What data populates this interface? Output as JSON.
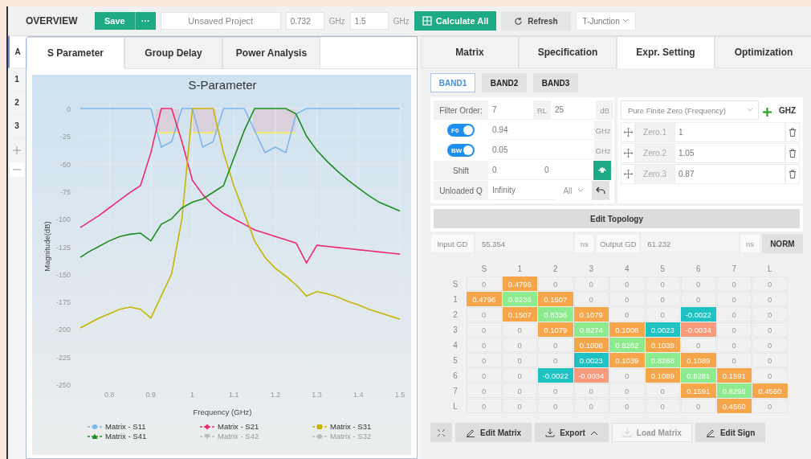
{
  "toolbar": {
    "title": "OVERVIEW",
    "save": "Save",
    "more": "···",
    "project": {
      "placeholder": "Unsaved Project"
    },
    "freq_start": "0.732",
    "freq_start_unit": "GHz",
    "freq_stop": "1.5",
    "freq_stop_unit": "GHz",
    "calculate": "Calculate All",
    "refresh": "Refresh",
    "junction": "T-Junction"
  },
  "sidebar": {
    "items": [
      {
        "label": "A",
        "selected": true
      },
      {
        "label": "1",
        "selected": false
      },
      {
        "label": "2",
        "selected": false
      },
      {
        "label": "3",
        "selected": false
      }
    ]
  },
  "left_tabs": [
    {
      "label": "S Parameter",
      "selected": true
    },
    {
      "label": "Group Delay",
      "selected": false
    },
    {
      "label": "Power Analysis",
      "selected": false
    }
  ],
  "chart": {
    "chart_data": {
      "type": "line",
      "title": "S-Parameter",
      "xlabel": "Frequency (GHz)",
      "ylabel": "Magnitude(dB)",
      "x": [
        0.73,
        0.75,
        0.775,
        0.8,
        0.825,
        0.85,
        0.875,
        0.9,
        0.925,
        0.95,
        0.975,
        1.0,
        1.025,
        1.05,
        1.075,
        1.1,
        1.125,
        1.15,
        1.175,
        1.2,
        1.225,
        1.25,
        1.275,
        1.3,
        1.325,
        1.35,
        1.375,
        1.4,
        1.425,
        1.45,
        1.475,
        1.5
      ],
      "series": [
        {
          "name": "Matrix - S11",
          "color": "#7eb6ec",
          "values": [
            0,
            0,
            0,
            0,
            0,
            0,
            0,
            0,
            -35,
            -30,
            0,
            0,
            -35,
            -30,
            0,
            0,
            0,
            -20,
            -40,
            -35,
            -40,
            -5,
            0,
            0,
            0,
            0,
            0,
            0,
            0,
            0,
            0,
            0
          ]
        },
        {
          "name": "Matrix - S21",
          "color": "#f0286e",
          "values": [
            -108,
            -103,
            -97,
            -90,
            -83,
            -76,
            -70,
            -40,
            0,
            0,
            -30,
            -65,
            -78,
            -88,
            -95,
            -100,
            -105,
            -110,
            -113,
            -116,
            -119,
            -122,
            -140,
            -124,
            -125,
            -126,
            -127,
            -128,
            -129,
            -130,
            -131,
            -132
          ]
        },
        {
          "name": "Matrix - S31",
          "color": "#c8b400",
          "values": [
            -199,
            -195,
            -190,
            -186,
            -182,
            -180,
            -182,
            -190,
            -170,
            -150,
            -100,
            0,
            0,
            0,
            -40,
            -70,
            -95,
            -120,
            -135,
            -145,
            -152,
            -160,
            -170,
            -166,
            -168,
            -171,
            -175,
            -178,
            -182,
            -185,
            -188,
            -191
          ]
        },
        {
          "name": "Matrix - S41",
          "color": "#1e8c1e",
          "values": [
            -135,
            -130,
            -125,
            -120,
            -116,
            -114,
            -113,
            -120,
            -105,
            -100,
            -90,
            -85,
            -82,
            -76,
            -70,
            -45,
            -20,
            0,
            0,
            0,
            0,
            -5,
            -25,
            -38,
            -48,
            -57,
            -65,
            -72,
            -79,
            -85,
            -89,
            -93
          ]
        },
        {
          "name": "Matrix - S42",
          "values": [
            null,
            null,
            null,
            null,
            null,
            null,
            null,
            null,
            null,
            null,
            null,
            null,
            null,
            null,
            null,
            null,
            null,
            null,
            null,
            null,
            null,
            null,
            null,
            null,
            null,
            null,
            null,
            null,
            null,
            null,
            null,
            null
          ]
        },
        {
          "name": "Matrix - S32",
          "values": [
            null,
            null,
            null,
            null,
            null,
            null,
            null,
            null,
            null,
            null,
            null,
            null,
            null,
            null,
            null,
            null,
            null,
            null,
            null,
            null,
            null,
            null,
            null,
            null,
            null,
            null,
            null,
            null,
            null,
            null,
            null,
            null
          ]
        }
      ],
      "grid": true,
      "xlim": [
        0.73,
        1.5
      ],
      "ylim": [
        -250,
        0
      ],
      "xticks": [
        0.8,
        0.9,
        1,
        1.1,
        1.2,
        1.3,
        1.4,
        1.5
      ],
      "yticks": [
        0,
        -25,
        -50,
        -75,
        -100,
        -125,
        -150,
        -175,
        -200,
        -225,
        -250
      ]
    },
    "legend": [
      {
        "visible": true
      },
      {
        "visible": true
      },
      {
        "visible": true
      },
      {
        "visible": true
      },
      {
        "visible": false
      },
      {
        "visible": false
      }
    ]
  },
  "right_tabs": [
    {
      "label": "Matrix",
      "selected": false
    },
    {
      "label": "Specification",
      "selected": false
    },
    {
      "label": "Expr. Setting",
      "selected": true
    },
    {
      "label": "Optimization",
      "selected": false
    }
  ],
  "bands": [
    {
      "label": "BAND1",
      "selected": true
    },
    {
      "label": "BAND2",
      "selected": false
    },
    {
      "label": "BAND3",
      "selected": false
    }
  ],
  "filter": {
    "order_label": "Filter Order:",
    "order": "7",
    "rl_label": "RL",
    "rl": "25",
    "rl_unit": "dB",
    "f0": {
      "label": "F0",
      "on": true,
      "value": "0.94",
      "unit": "GHz"
    },
    "bw": {
      "label": "BW",
      "on": true,
      "value": "0.05",
      "unit": "GHz"
    },
    "shift_label": "Shift",
    "shift": [
      "0",
      "0"
    ],
    "q_label": "Unloaded Q",
    "q": "Infinity",
    "q_scope": "All"
  },
  "zeros": {
    "type": "Pure Finite Zero (Frequency)",
    "unit": "GHZ",
    "items": [
      {
        "label": "Zero.1",
        "value": "1"
      },
      {
        "label": "Zero.2",
        "value": "1.05"
      },
      {
        "label": "Zero.3",
        "value": "0.87"
      }
    ]
  },
  "topology_button": "Edit Topology",
  "gd": {
    "input_label": "Input GD",
    "input": "55.354",
    "input_unit": "ns",
    "output_label": "Output GD",
    "output": "61.232",
    "output_unit": "ns",
    "norm": "NORM"
  },
  "matrix": {
    "columns": [
      "S",
      "1",
      "2",
      "3",
      "4",
      "5",
      "6",
      "7",
      "L"
    ],
    "rows": [
      {
        "label": "S",
        "cells": [
          {
            "value": "0"
          },
          {
            "value": "0.4796",
            "color": "#f7a54a"
          },
          {
            "value": "0"
          },
          {
            "value": "0"
          },
          {
            "value": "0"
          },
          {
            "value": "0"
          },
          {
            "value": "0"
          },
          {
            "value": "0"
          },
          {
            "value": "0"
          }
        ]
      },
      {
        "label": "1",
        "cells": [
          {
            "value": "0.4796",
            "color": "#f7a54a"
          },
          {
            "value": "0.9236",
            "color": "#8eea8e"
          },
          {
            "value": "0.1507",
            "color": "#f7a54a"
          },
          {
            "value": "0"
          },
          {
            "value": "0"
          },
          {
            "value": "0"
          },
          {
            "value": "0"
          },
          {
            "value": "0"
          },
          {
            "value": "0"
          }
        ]
      },
      {
        "label": "2",
        "cells": [
          {
            "value": "0"
          },
          {
            "value": "0.1507",
            "color": "#f7a54a"
          },
          {
            "value": "0.8336",
            "color": "#8eea8e"
          },
          {
            "value": "0.1079",
            "color": "#f7a54a"
          },
          {
            "value": "0"
          },
          {
            "value": "0"
          },
          {
            "value": "-0.0022",
            "color": "#1fc2c2"
          },
          {
            "value": "0"
          },
          {
            "value": "0"
          }
        ]
      },
      {
        "label": "3",
        "cells": [
          {
            "value": "0"
          },
          {
            "value": "0"
          },
          {
            "value": "0.1079",
            "color": "#f7a54a"
          },
          {
            "value": "0.8274",
            "color": "#8eea8e"
          },
          {
            "value": "0.1008",
            "color": "#f7a54a"
          },
          {
            "value": "0.0023",
            "color": "#1fc2c2"
          },
          {
            "value": "-0.0034",
            "color": "#f99a7a"
          },
          {
            "value": "0"
          },
          {
            "value": "0"
          }
        ]
      },
      {
        "label": "4",
        "cells": [
          {
            "value": "0"
          },
          {
            "value": "0"
          },
          {
            "value": "0"
          },
          {
            "value": "0.1008",
            "color": "#f7a54a"
          },
          {
            "value": "0.8262",
            "color": "#8eea8e"
          },
          {
            "value": "0.1039",
            "color": "#f7a54a"
          },
          {
            "value": "0"
          },
          {
            "value": "0"
          },
          {
            "value": "0"
          }
        ]
      },
      {
        "label": "5",
        "cells": [
          {
            "value": "0"
          },
          {
            "value": "0"
          },
          {
            "value": "0"
          },
          {
            "value": "0.0023",
            "color": "#1fc2c2"
          },
          {
            "value": "0.1039",
            "color": "#f7a54a"
          },
          {
            "value": "0.8268",
            "color": "#8eea8e"
          },
          {
            "value": "0.1089",
            "color": "#f7a54a"
          },
          {
            "value": "0"
          },
          {
            "value": "0"
          }
        ]
      },
      {
        "label": "6",
        "cells": [
          {
            "value": "0"
          },
          {
            "value": "0"
          },
          {
            "value": "-0.0022",
            "color": "#1fc2c2"
          },
          {
            "value": "-0.0034",
            "color": "#f99a7a"
          },
          {
            "value": "0"
          },
          {
            "value": "0.1089",
            "color": "#f7a54a"
          },
          {
            "value": "0.8281",
            "color": "#8eea8e"
          },
          {
            "value": "0.1591",
            "color": "#f7a54a"
          },
          {
            "value": "0"
          }
        ]
      },
      {
        "label": "7",
        "cells": [
          {
            "value": "0"
          },
          {
            "value": "0"
          },
          {
            "value": "0"
          },
          {
            "value": "0"
          },
          {
            "value": "0"
          },
          {
            "value": "0"
          },
          {
            "value": "0.1591",
            "color": "#f7a54a"
          },
          {
            "value": "0.8296",
            "color": "#8eea8e"
          },
          {
            "value": "0.4560",
            "color": "#f7a54a"
          }
        ]
      },
      {
        "label": "L",
        "cells": [
          {
            "value": "0"
          },
          {
            "value": "0"
          },
          {
            "value": "0"
          },
          {
            "value": "0"
          },
          {
            "value": "0"
          },
          {
            "value": "0"
          },
          {
            "value": "0"
          },
          {
            "value": "0.4560",
            "color": "#f7a54a"
          },
          {
            "value": "0"
          }
        ]
      }
    ]
  },
  "actions": [
    {
      "kind": "edit",
      "label": "Edit Matrix",
      "disabled": false
    },
    {
      "kind": "export",
      "label": "Export",
      "disabled": false
    },
    {
      "kind": "load",
      "label": "Load Matrix",
      "disabled": true
    },
    {
      "kind": "edit",
      "label": "Edit Sign",
      "disabled": false
    }
  ]
}
